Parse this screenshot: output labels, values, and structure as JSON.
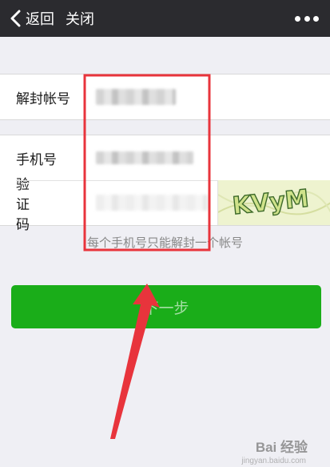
{
  "navbar": {
    "back_icon": "chevron-left-icon",
    "back_label": "返回",
    "close_label": "关闭",
    "more_icon": "more-dots-icon"
  },
  "form": {
    "unblock_account_label": "解封帐号",
    "phone_label": "手机号",
    "code_label": "验证码",
    "captcha_text": "KVyM"
  },
  "hint": "每个手机号只能解封一个帐号",
  "next_button_label": "下一步",
  "watermark": {
    "brand": "Bai 经验",
    "url": "jingyan.baidu.com"
  },
  "colors": {
    "navbar": "#2b2b2f",
    "primary_button": "#1aad19",
    "annotation": "#e8343c",
    "background": "#efeff4"
  }
}
